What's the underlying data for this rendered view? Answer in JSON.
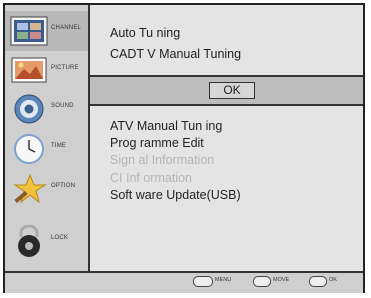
{
  "sidebar": {
    "items": [
      {
        "label": "CHANNEL",
        "icon": "channel-icon",
        "active": true
      },
      {
        "label": "PICTURE",
        "icon": "picture-icon"
      },
      {
        "label": "SOUND",
        "icon": "sound-icon"
      },
      {
        "label": "TIME",
        "icon": "clock-icon"
      },
      {
        "label": "OPTION",
        "icon": "option-star-icon"
      },
      {
        "label": "LOCK",
        "icon": "lock-icon"
      }
    ]
  },
  "menu": {
    "top_items": [
      "Auto Tu ning",
      "CADT V Manual Tuning"
    ],
    "ok_label": "OK",
    "items": [
      {
        "label": "ATV Manual Tun ing",
        "enabled": true
      },
      {
        "label": "Prog ramme Edit",
        "enabled": true
      },
      {
        "label": "Sign al Information",
        "enabled": false
      },
      {
        "label": "CI Inf ormation",
        "enabled": false
      },
      {
        "label": "Soft ware Update(USB)",
        "enabled": true
      }
    ]
  },
  "footer": {
    "menu_label": "MENU",
    "move_label": "MOVE",
    "ok_label": "OK"
  }
}
